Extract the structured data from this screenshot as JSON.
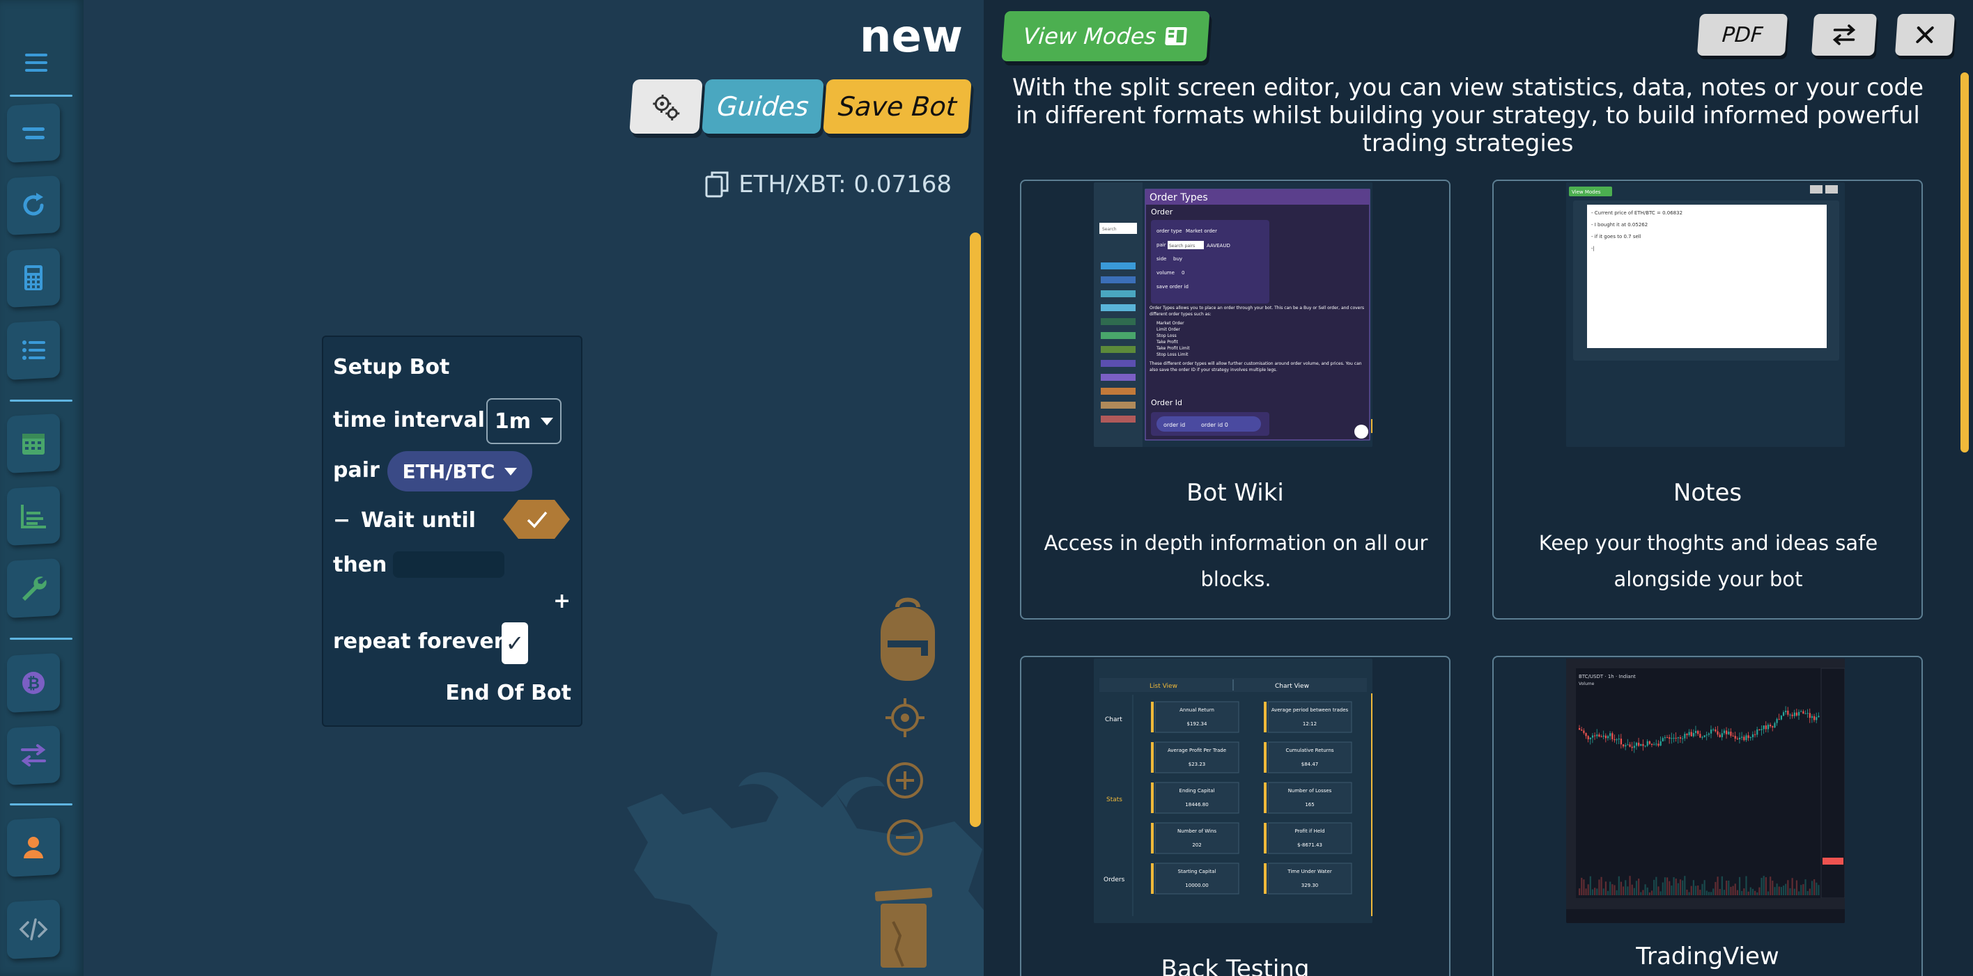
{
  "workspace": {
    "bot_name": "new",
    "guides_label": "Guides",
    "save_label": "Save Bot",
    "price_text": "ETH/XBT: 0.07168"
  },
  "setup_block": {
    "title": "Setup Bot",
    "time_interval_label": "time interval",
    "time_interval_value": "1m",
    "pair_label": "pair",
    "pair_value": "ETH/BTC",
    "minus": "−",
    "wait_label": "Wait until",
    "then_label": "then",
    "plus": "+",
    "repeat_label": "repeat forever",
    "end_label": "End Of Bot"
  },
  "toolbox": {
    "categories": [
      "lines-icon",
      "refresh-icon",
      "calculator-icon",
      "list-icon",
      "calendar-icon",
      "chart-icon",
      "wrench-icon",
      "bitcoin-icon",
      "swap-icon",
      "user-icon",
      "code-icon"
    ]
  },
  "panel": {
    "view_modes_label": "View Modes",
    "pdf_label": "PDF",
    "intro": "With the split screen editor, you can view statistics, data, notes or your code in different formats whilst building your strategy, to build informed powerful trading strategies",
    "cards": [
      {
        "title": "Bot Wiki",
        "description": "Access in depth information on all our blocks."
      },
      {
        "title": "Notes",
        "description": "Keep your thoghts and ideas safe alongside your bot"
      },
      {
        "title": "Back Testing",
        "description": ""
      },
      {
        "title": "TradingView",
        "description": ""
      }
    ],
    "wiki_thumb": {
      "header": "Order Types",
      "subheader": "Order",
      "rows": [
        "order type",
        "Market order",
        "pair",
        "Search pairs",
        "AAVEAUD",
        "side",
        "buy",
        "volume",
        "0",
        "save order id"
      ],
      "desc": "Order Types allows you to place an order through your bot. This can be a Buy or Sell order, and covers different order types such as:",
      "bullets": [
        "Market Order",
        "Limit Order",
        "Stop Loss",
        "Take Profit",
        "Take Profit Limit",
        "Stop Loss Limit"
      ],
      "footer": "These different order types will allow further customisation around order volume, and prices. You can also save the order ID if your strategy involves multiple legs.",
      "section2": "Order Id",
      "pill_label": "order id",
      "pill_value": "order id 0",
      "search_placeholder": "Search"
    },
    "notes_thumb": {
      "button": "View Modes",
      "lines": [
        "- Current price of ETH/BTC = 0.06832",
        "- I bought it at 0.05262",
        "- if it goes to 0.7 sell",
        "-|"
      ]
    },
    "bt_thumb": {
      "tab_list": "List View",
      "tab_chart": "Chart View",
      "side": [
        "Chart",
        "Stats",
        "Orders"
      ],
      "stats": [
        {
          "label": "Annual Return",
          "value": "$192.34"
        },
        {
          "label": "Average period between trades",
          "value": "12:12"
        },
        {
          "label": "Average Profit Per Trade",
          "value": "$23.23"
        },
        {
          "label": "Cumulative Returns",
          "value": "$84.47"
        },
        {
          "label": "Ending Capital",
          "value": "18446.80"
        },
        {
          "label": "Number of Losses",
          "value": "165"
        },
        {
          "label": "Number of Wins",
          "value": "202"
        },
        {
          "label": "Profit if Held",
          "value": "$-8671.43"
        },
        {
          "label": "Starting Capital",
          "value": "10000.00"
        },
        {
          "label": "Time Under Water",
          "value": "329.30"
        }
      ]
    },
    "tv_thumb": {
      "symbol": "BTC/USDT · 1h · Indiant",
      "volume": "Volume"
    }
  },
  "colors": {
    "workspace_bg": "#1e3a50",
    "panel_bg": "#16293a",
    "accent_yellow": "#f0b93a",
    "view_modes_green": "#4caf50",
    "guides_blue": "#4aa7c0",
    "toolbox_icon_blue": "#3a9ad8",
    "toolbox_icon_green": "#49a66b",
    "toolbox_icon_purple": "#7b5fc4"
  }
}
